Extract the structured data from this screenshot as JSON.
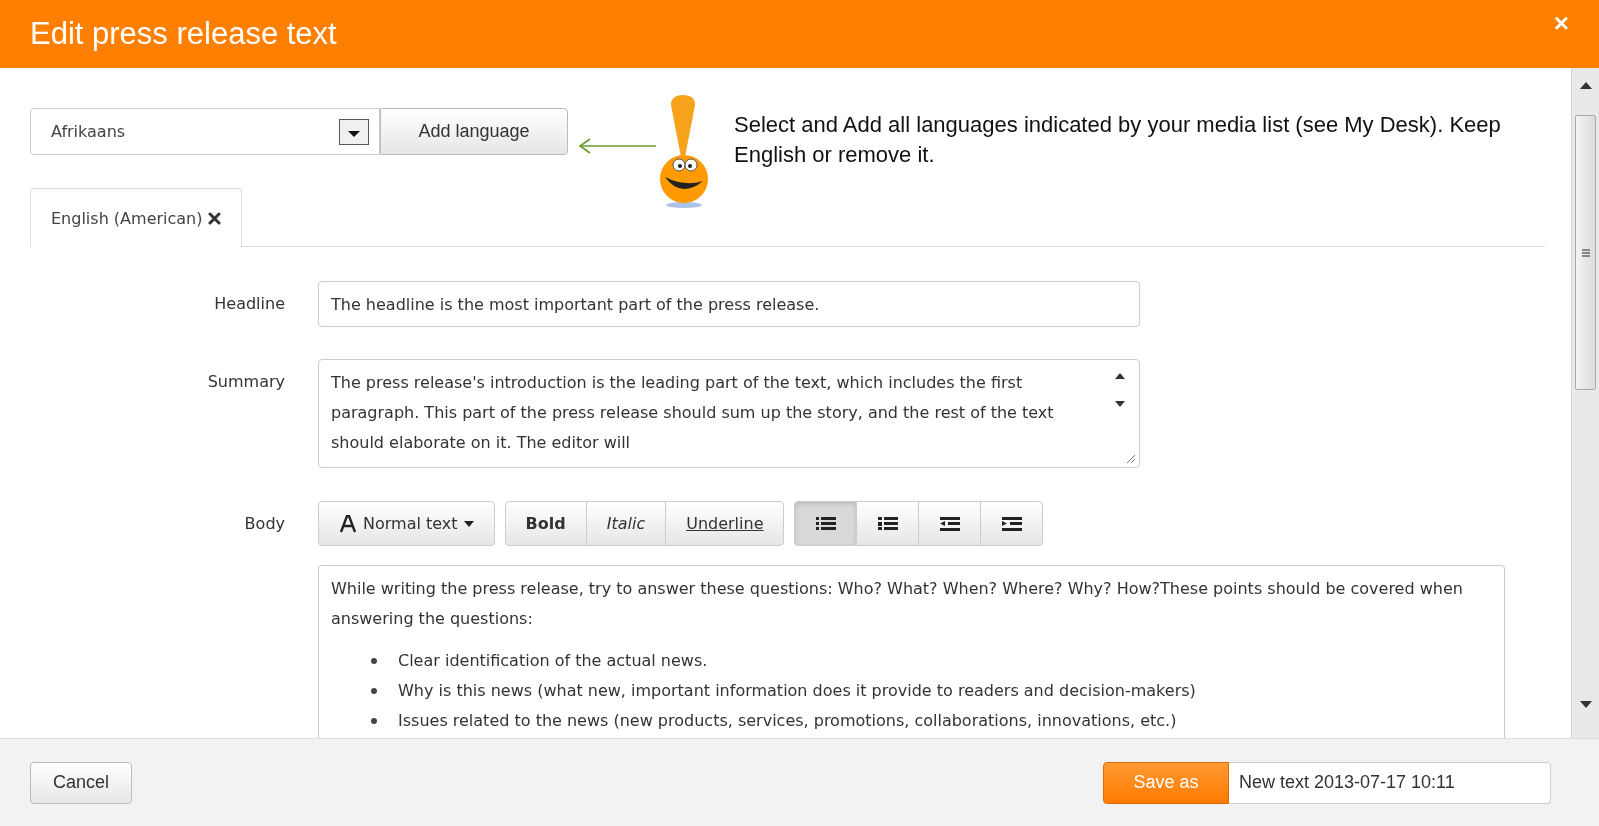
{
  "window": {
    "title": "Edit press release text",
    "close": "×"
  },
  "language_picker": {
    "value": "Afrikaans",
    "add_button": "Add language"
  },
  "hint": "Select and Add all languages indicated by your media list (see My Desk). Keep English or remove it.",
  "tabs": [
    {
      "label": "English (American)",
      "selected": true
    }
  ],
  "form": {
    "headline": {
      "label": "Headline",
      "value": "The headline is the most important part of the press release."
    },
    "summary": {
      "label": "Summary",
      "value": "The press release's introduction is the leading part of the text, which includes the first paragraph. This part of the press release should sum up the story, and the rest of the text should elaborate on it. The editor will"
    },
    "body": {
      "label": "Body",
      "toolbar": {
        "style_menu": "Normal text",
        "format_buttons": [
          {
            "label": "Bold",
            "kind": "bold"
          },
          {
            "label": "Italic",
            "kind": "italic"
          },
          {
            "label": "Underline",
            "kind": "underline"
          }
        ],
        "list_buttons": [
          {
            "kind": "bullets",
            "selected": true
          },
          {
            "kind": "numbers",
            "selected": false
          },
          {
            "kind": "outdent",
            "selected": false
          },
          {
            "kind": "indent",
            "selected": false
          }
        ]
      },
      "paragraph": "While writing the press release, try to answer these questions: Who? What? When? Where? Why? How?These points should be covered when answering the questions:",
      "bullets": [
        "Clear identification of the actual news.",
        "Why is this news (what new, important information does it provide to readers and decision-makers)",
        "Issues related to the news (new products, services, promotions, collaborations, innovations, etc.)"
      ]
    }
  },
  "footer": {
    "cancel": "Cancel",
    "save_as": "Save as",
    "name_value": "New text 2013-07-17 10:11"
  }
}
